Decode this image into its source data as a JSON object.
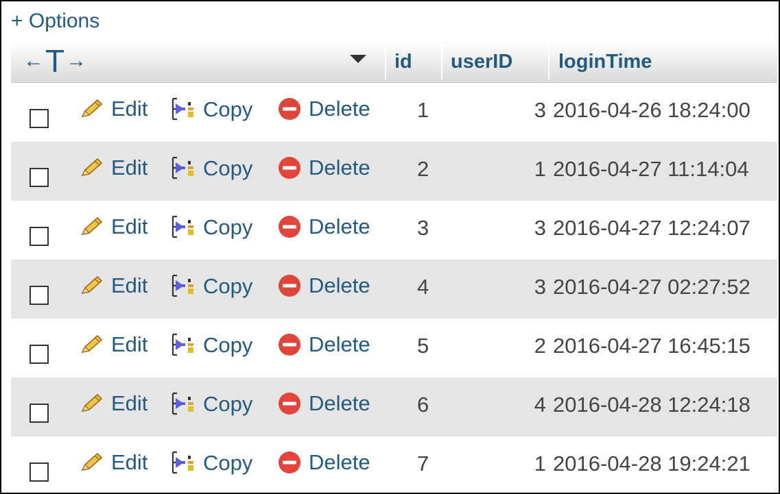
{
  "options_link": "+ Options",
  "header": {
    "arrow_left": "←",
    "arrow_t": "T",
    "arrow_right": "→",
    "columns": [
      "id",
      "userID",
      "loginTime"
    ]
  },
  "actions": {
    "edit": "Edit",
    "copy": "Copy",
    "delete": "Delete"
  },
  "rows": [
    {
      "id": "1",
      "userID": "3",
      "loginTime": "2016-04-26 18:24:00"
    },
    {
      "id": "2",
      "userID": "1",
      "loginTime": "2016-04-27 11:14:04"
    },
    {
      "id": "3",
      "userID": "3",
      "loginTime": "2016-04-27 12:24:07"
    },
    {
      "id": "4",
      "userID": "3",
      "loginTime": "2016-04-27 02:27:52"
    },
    {
      "id": "5",
      "userID": "2",
      "loginTime": "2016-04-27 16:45:15"
    },
    {
      "id": "6",
      "userID": "4",
      "loginTime": "2016-04-28 12:24:18"
    },
    {
      "id": "7",
      "userID": "1",
      "loginTime": "2016-04-28 19:24:21"
    }
  ],
  "colors": {
    "link": "#235a81",
    "row_alt": "#e5e5e5",
    "delete_icon": "#e0443a"
  }
}
